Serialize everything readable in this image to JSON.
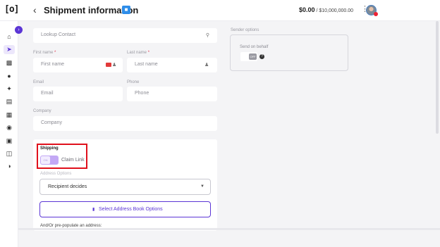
{
  "header": {
    "logo": "[o]",
    "back_icon": "chevron-left-icon",
    "title": "Shipment information",
    "title_icon": "info-badge-icon",
    "balance": "$0.00",
    "balance_limit": " / $10,000,000.00",
    "menu_icon": "more-vertical-icon"
  },
  "sidebar": {
    "collapse_icon": "chevron-right-icon",
    "items": [
      "home-icon",
      "send-icon",
      "gift-icon",
      "tag-icon",
      "rocket-icon",
      "clipboard-icon",
      "building-icon",
      "gift-box-icon",
      "globe-icon",
      "inbox-icon",
      "shield-user-icon"
    ],
    "active_index": 1
  },
  "form": {
    "lookup_placeholder": "Lookup Contact",
    "first_name_label": "First name",
    "first_name_placeholder": "First name",
    "last_name_label": "Last name",
    "last_name_placeholder": "Last name",
    "required_mark": "*",
    "email_label": "Email",
    "email_placeholder": "Email",
    "phone_label": "Phone",
    "phone_placeholder": "Phone",
    "company_label": "Company",
    "company_placeholder": "Company"
  },
  "sender": {
    "section_label": "Sender options",
    "send_on_behalf": "Send on behalf",
    "toggle_state": "OFF",
    "help": "?"
  },
  "shipping": {
    "title": "Shipping",
    "toggle_state": "ON",
    "claim_link": "Claim Link",
    "address_options_label": "Address Options",
    "address_option_selected": "Recipient decides",
    "address_book_button": "Select Address Book Options",
    "prepopulate_text": "And/Or pre-populate an address:"
  },
  "colors": {
    "accent": "#5b35d5",
    "toggle_on": "#c3a8f5",
    "highlight_box": "#e0101c",
    "title_icon": "#2e8de8",
    "background": "#f4f4f6"
  }
}
